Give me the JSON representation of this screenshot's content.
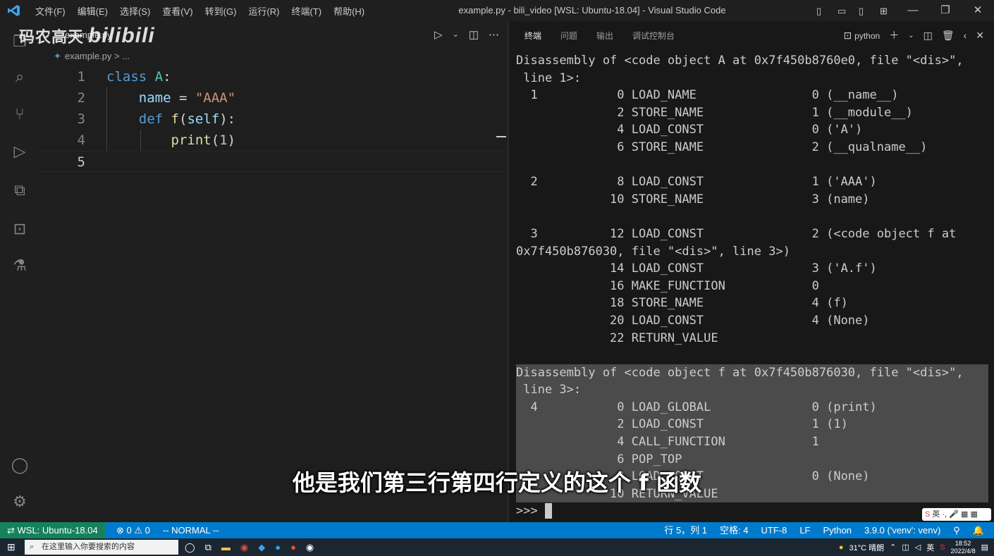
{
  "window": {
    "menu": [
      "文件(F)",
      "编辑(E)",
      "选择(S)",
      "查看(V)",
      "转到(G)",
      "运行(R)",
      "终端(T)",
      "帮助(H)"
    ],
    "title": "example.py - bili_video [WSL: Ubuntu-18.04] - Visual Studio Code"
  },
  "watermark": {
    "text": "码农高天",
    "logo": "bilibili"
  },
  "editor": {
    "tab_label": "example.py",
    "breadcrumb": "example.py > ...",
    "line_numbers": [
      "1",
      "2",
      "3",
      "4",
      "5"
    ],
    "current_line": 5
  },
  "panel": {
    "tabs": [
      "终端",
      "问题",
      "输出",
      "调试控制台"
    ],
    "active_tab": "终端",
    "shell_label": "python"
  },
  "terminal": {
    "lines": [
      "Disassembly of <code object A at 0x7f450b8760e0, file \"<dis>\",",
      " line 1>:",
      "  1           0 LOAD_NAME                0 (__name__)",
      "              2 STORE_NAME               1 (__module__)",
      "              4 LOAD_CONST               0 ('A')",
      "              6 STORE_NAME               2 (__qualname__)",
      "",
      "  2           8 LOAD_CONST               1 ('AAA')",
      "             10 STORE_NAME               3 (name)",
      "",
      "  3          12 LOAD_CONST               2 (<code object f at",
      "0x7f450b876030, file \"<dis>\", line 3>)",
      "             14 LOAD_CONST               3 ('A.f')",
      "             16 MAKE_FUNCTION            0",
      "             18 STORE_NAME               4 (f)",
      "             20 LOAD_CONST               4 (None)",
      "             22 RETURN_VALUE",
      "",
      "Disassembly of <code object f at 0x7f450b876030, file \"<dis>\",",
      " line 3>:",
      "  4           0 LOAD_GLOBAL              0 (print)",
      "              2 LOAD_CONST               1 (1)",
      "              4 CALL_FUNCTION            1",
      "              6 POP_TOP",
      "              8 LOAD_CONST               0 (None)",
      "             10 RETURN_VALUE"
    ],
    "prompt": ">>> "
  },
  "subtitle": "他是我们第三行第四行定义的这个 f 函数",
  "statusbar": {
    "remote": "WSL: Ubuntu-18.04",
    "problems": "⊗ 0 ⚠ 0",
    "mode": "-- NORMAL --",
    "position": "行 5，列 1",
    "spaces": "空格: 4",
    "encoding": "UTF-8",
    "eol": "LF",
    "language": "Python",
    "interpreter": "3.9.0 ('venv': venv)"
  },
  "taskbar": {
    "search_placeholder": "在这里输入你要搜索的内容",
    "weather": "31°C 晴朗",
    "ime": "英",
    "time": "18:52",
    "date": "2022/4/8"
  },
  "ime_bar": {
    "label": "英"
  },
  "colors": {
    "statusbar": "#007acc",
    "remote": "#16825d",
    "keyword": "#569cd6",
    "string": "#ce9178"
  }
}
